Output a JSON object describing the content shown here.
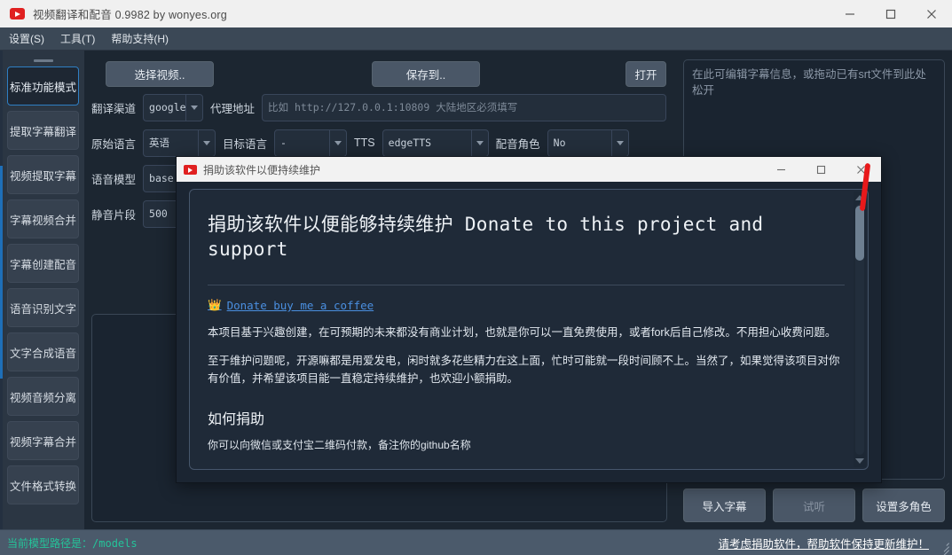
{
  "window": {
    "title": "视频翻译和配音 0.9982 by wonyes.org",
    "icon": "video-icon",
    "controls": {
      "minimize": "minimize-icon",
      "maximize": "maximize-icon",
      "close": "close-icon"
    }
  },
  "menubar": {
    "items": [
      "设置(S)",
      "工具(T)",
      "帮助支持(H)"
    ]
  },
  "sidebar": {
    "items": [
      {
        "label": "标准功能模式",
        "active": true
      },
      {
        "label": "提取字幕翻译",
        "active": false
      },
      {
        "label": "视频提取字幕",
        "active": false
      },
      {
        "label": "字幕视频合并",
        "active": false
      },
      {
        "label": "字幕创建配音",
        "active": false
      },
      {
        "label": "语音识别文字",
        "active": false
      },
      {
        "label": "文字合成语音",
        "active": false
      },
      {
        "label": "视频音频分离",
        "active": false
      },
      {
        "label": "视频字幕合并",
        "active": false
      },
      {
        "label": "文件格式转换",
        "active": false
      }
    ]
  },
  "toolbar": {
    "select_video": "选择视频..",
    "save_to": "保存到..",
    "open": "打开"
  },
  "form": {
    "translate_channel_label": "翻译渠道",
    "translate_channel_value": "google",
    "proxy_label": "代理地址",
    "proxy_placeholder": "比如 http://127.0.0.1:10809 大陆地区必须填写",
    "source_lang_label": "原始语言",
    "source_lang_value": "英语",
    "target_lang_label": "目标语言",
    "target_lang_value": "-",
    "tts_label": "TTS",
    "tts_value": "edgeTTS",
    "voice_role_label": "配音角色",
    "voice_role_value": "No",
    "speech_model_label": "语音模型",
    "speech_model_value": "base",
    "silence_label": "静音片段",
    "silence_value": "500"
  },
  "right_panel": {
    "subtitle_placeholder": "在此可编辑字幕信息，或拖动已有srt文件到此处松开",
    "buttons": [
      {
        "label": "导入字幕",
        "dim": false
      },
      {
        "label": "试听",
        "dim": true
      },
      {
        "label": "设置多角色",
        "dim": false
      }
    ]
  },
  "statusbar": {
    "left_cn": "当前模型路径是：",
    "left_path": "/models",
    "right": "请考虑捐助软件，帮助软件保持更新维护！",
    "left_color": "#24c49a"
  },
  "dialog": {
    "title": "捐助该软件以便持续维护",
    "icon": "video-icon",
    "controls": {
      "minimize": "minimize-icon",
      "maximize": "maximize-icon",
      "close": "close-icon"
    },
    "heading": "捐助该软件以便能够持续维护 Donate to this project and support",
    "donate_link": "Donate buy me a coffee",
    "donate_link_icon": "crown-icon",
    "paragraph1": "本项目基于兴趣创建，在可预期的未来都没有商业计划，也就是你可以一直免费使用，或者fork后自己修改。不用担心收费问题。",
    "paragraph2": "至于维护问题呢，开源嘛都是用爱发电，闲时就多花些精力在这上面，忙时可能就一段时间顾不上。当然了，如果觉得该项目对你有价值，并希望该项目能一直稳定持续维护，也欢迎小额捐助。",
    "heading2": "如何捐助",
    "paragraph3": "你可以向微信或支付宝二维码付款，备注你的github名称"
  },
  "colors": {
    "accent": "#2f7fc4",
    "annotation": "#e8191b",
    "status_text": "#24c49a"
  }
}
